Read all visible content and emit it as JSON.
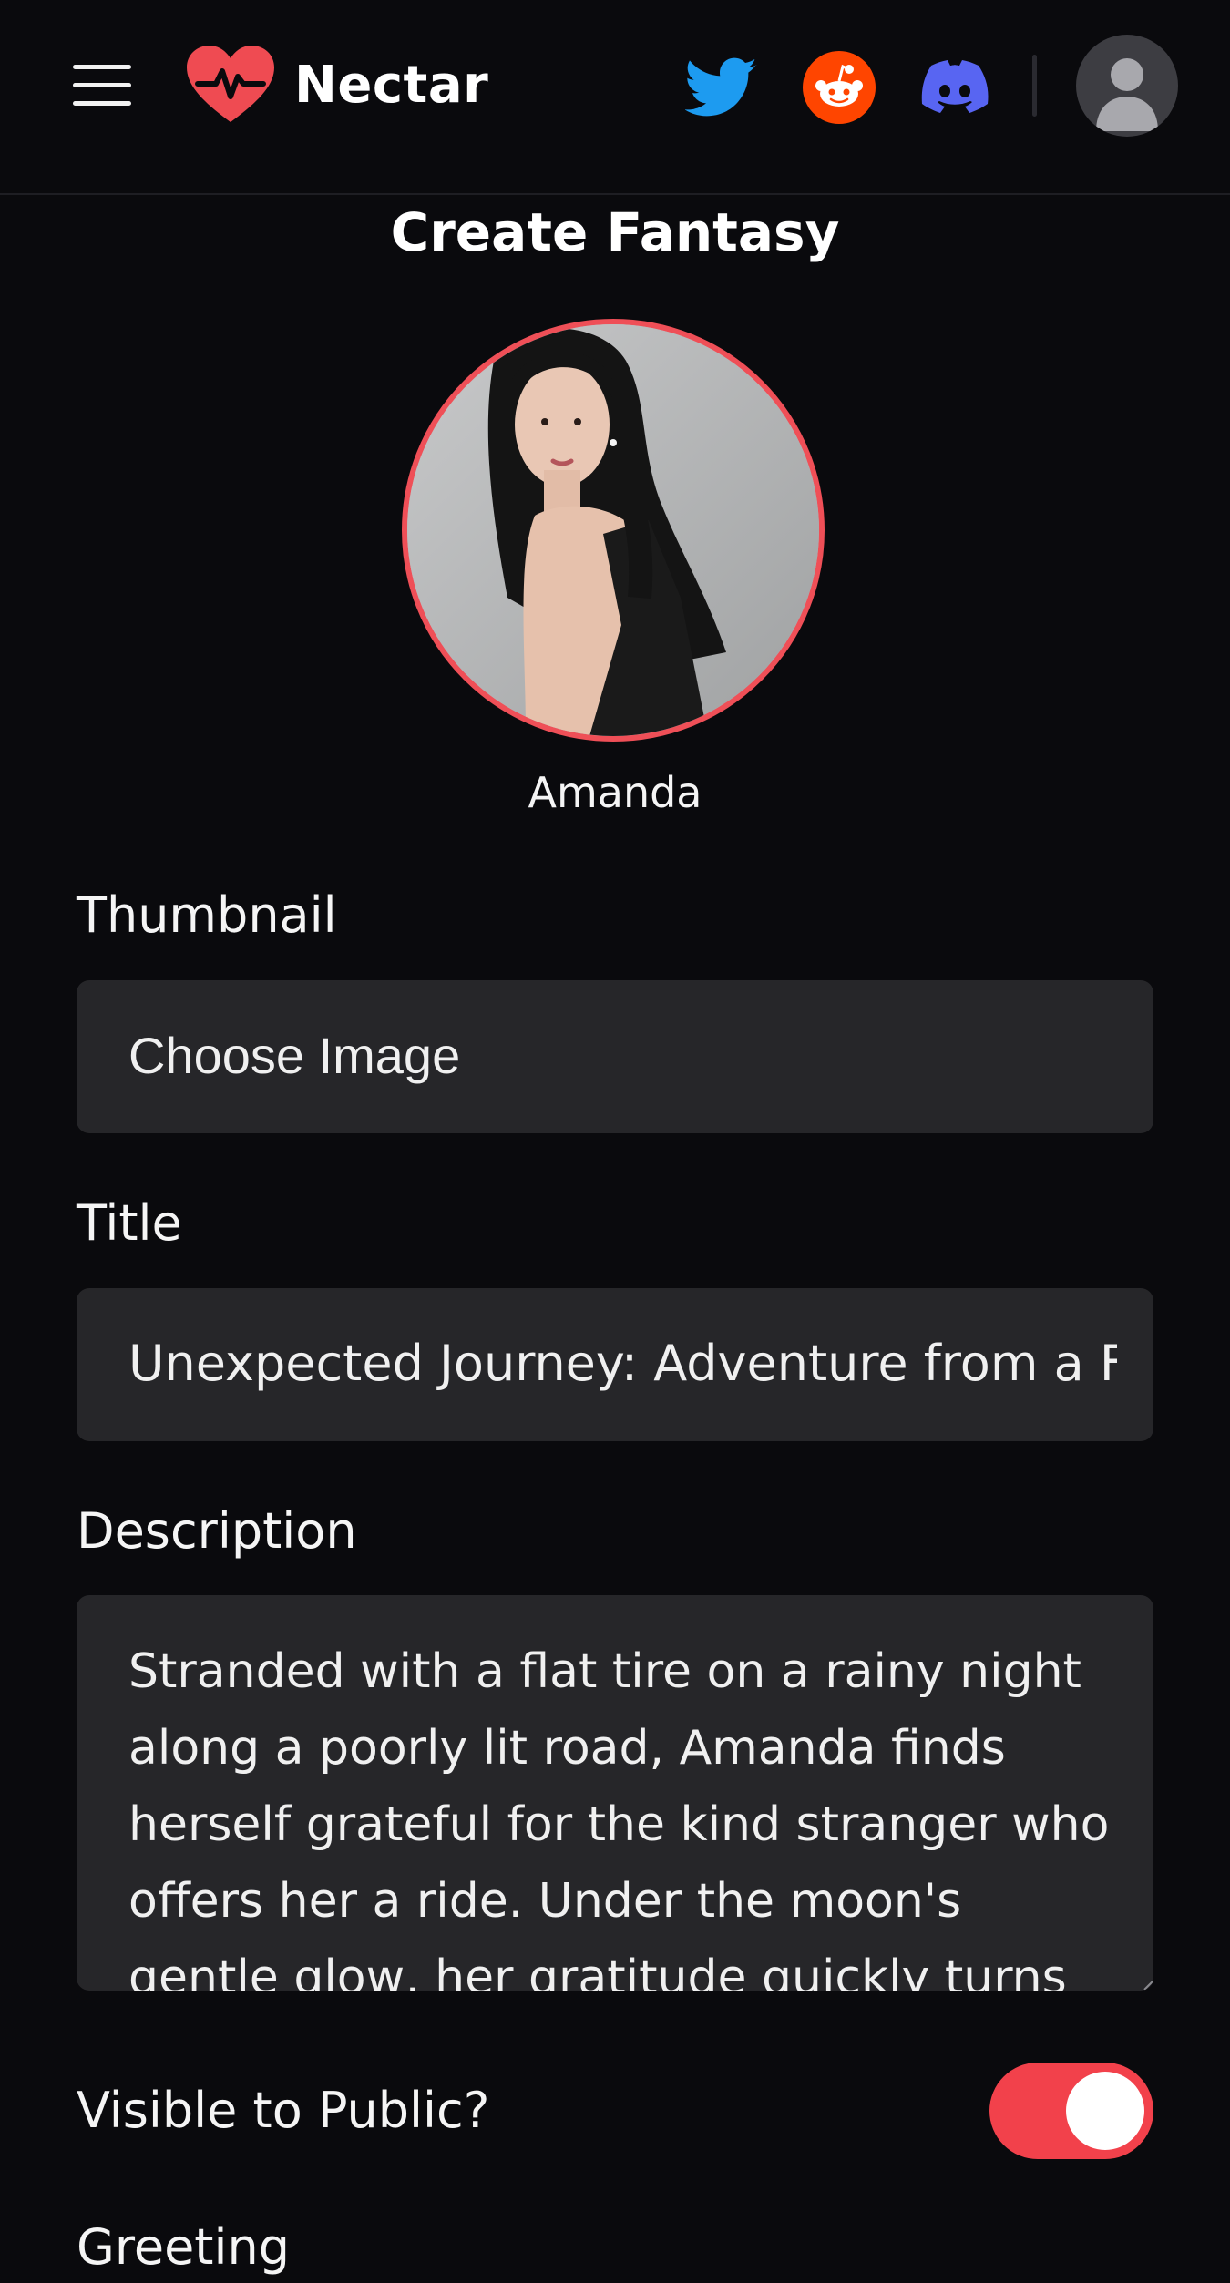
{
  "header": {
    "brand": "Nectar",
    "brand_color": "#ef4b52",
    "icons": [
      "menu-icon",
      "heart-pulse-logo-icon",
      "twitter-icon",
      "reddit-icon",
      "discord-icon",
      "user-avatar-icon"
    ]
  },
  "page": {
    "title": "Create Fantasy"
  },
  "character": {
    "name": "Amanda"
  },
  "form": {
    "thumbnail_label": "Thumbnail",
    "thumbnail_button": "Choose Image",
    "title_label": "Title",
    "title_value": "Unexpected Journey: Adventure from a F",
    "description_label": "Description",
    "description_value": "Stranded with a flat tire on a rainy night along a poorly lit road, Amanda finds herself grateful for the kind stranger who offers her a ride. Under the moon's gentle glow, her gratitude quickly turns",
    "visibility_label": "Visible to Public?",
    "visibility_on": true,
    "greeting_label": "Greeting"
  },
  "colors": {
    "accent": "#f2414b",
    "background": "#0a0a0d",
    "field_bg": "#262629"
  }
}
